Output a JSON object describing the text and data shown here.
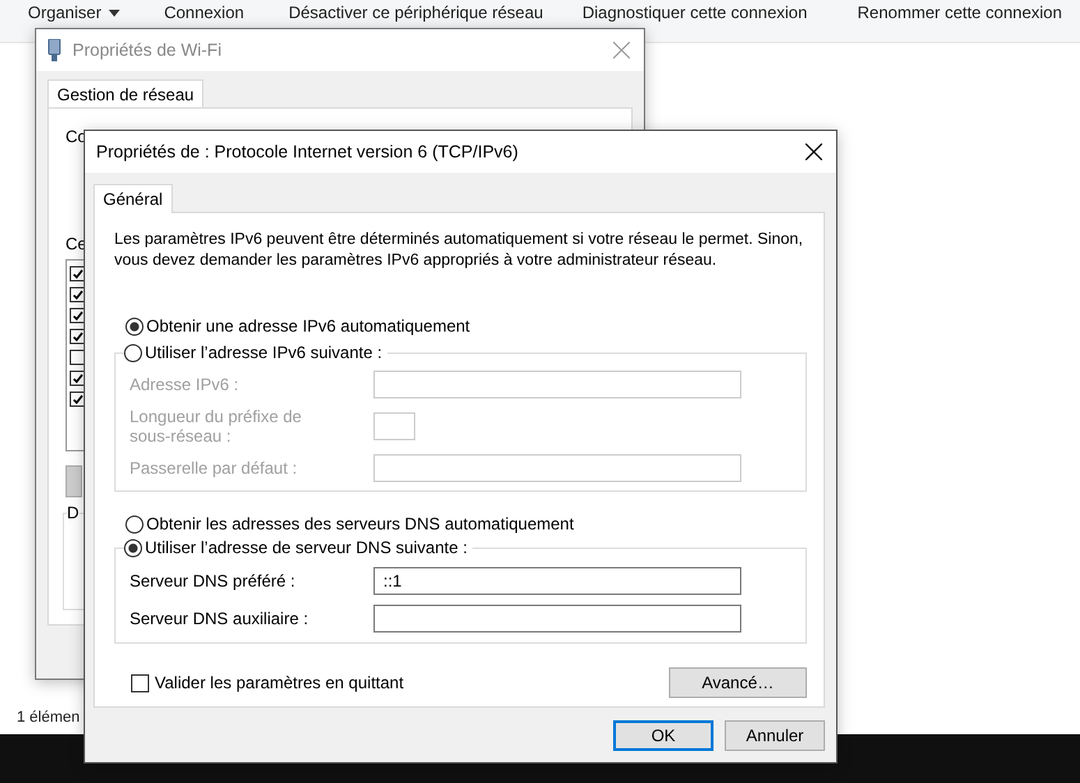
{
  "explorer": {
    "toolbar": [
      {
        "label": "Organiser",
        "dropdown": true
      },
      {
        "label": "Connexion",
        "dropdown": false
      },
      {
        "label": "Désactiver ce périphérique réseau",
        "dropdown": false
      },
      {
        "label": "Diagnostiquer cette connexion",
        "dropdown": false
      },
      {
        "label": "Renommer cette connexion",
        "dropdown": false
      }
    ],
    "status_bar": "1 élémen"
  },
  "wifi_dialog": {
    "title": "Propriétés de Wi-Fi",
    "tabs": [
      {
        "label": "Gestion de réseau",
        "selected": true
      }
    ],
    "connect_label": "Co",
    "components_label": "Ce",
    "components": [
      {
        "checked": true
      },
      {
        "checked": true
      },
      {
        "checked": true
      },
      {
        "checked": true
      },
      {
        "checked": false
      },
      {
        "checked": true
      },
      {
        "checked": true
      }
    ],
    "group_label": "D"
  },
  "ipv6_dialog": {
    "title": "Propriétés de : Protocole Internet version 6 (TCP/IPv6)",
    "tabs": [
      {
        "label": "Général",
        "selected": true
      }
    ],
    "description": "Les paramètres IPv6 peuvent être déterminés automatiquement si votre réseau le permet. Sinon, vous devez demander les paramètres IPv6 appropriés à votre administrateur réseau.",
    "address_auto": {
      "label": "Obtenir une adresse IPv6 automatiquement",
      "selected": true
    },
    "address_manual": {
      "label": "Utiliser l’adresse IPv6 suivante :",
      "selected": false,
      "fields": [
        {
          "label": "Adresse IPv6 :",
          "kind": "wide",
          "disabled": true
        },
        {
          "label": "Longueur du préfixe de sous-réseau :",
          "kind": "short",
          "disabled": true
        },
        {
          "label": "Passerelle par défaut :",
          "kind": "wide",
          "disabled": true
        }
      ]
    },
    "dns_auto": {
      "label": "Obtenir les adresses des serveurs DNS automatiquement",
      "selected": false
    },
    "dns_manual": {
      "label": "Utiliser l’adresse de serveur DNS suivante :",
      "selected": true,
      "fields": [
        {
          "label": "Serveur DNS préféré :",
          "kind": "wide",
          "value": "::1",
          "disabled": false
        },
        {
          "label": "Serveur DNS auxiliaire :",
          "kind": "wide",
          "disabled": false
        }
      ]
    },
    "validate": {
      "label": "Valider les paramètres en quittant",
      "checked": false
    },
    "advanced_button": "Avancé…",
    "buttons": [
      {
        "label": "OK",
        "default": true
      },
      {
        "label": "Annuler",
        "default": false
      }
    ]
  }
}
